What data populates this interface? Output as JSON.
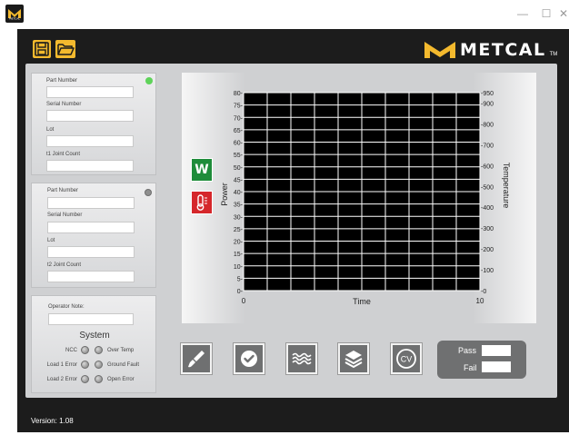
{
  "window": {
    "minimize_glyph": "—",
    "maximize_glyph": "☐",
    "close_glyph": "✕"
  },
  "brand": {
    "name": "METCAL",
    "tm": "TM"
  },
  "panel1": {
    "fields": [
      {
        "label": "Part Number",
        "value": ""
      },
      {
        "label": "Serial Number",
        "value": ""
      },
      {
        "label": "Lot",
        "value": ""
      },
      {
        "label": "t1 Joint Count",
        "value": ""
      }
    ],
    "led_color": "#5fd35a"
  },
  "panel2": {
    "fields": [
      {
        "label": "Part Number",
        "value": ""
      },
      {
        "label": "Serial Number",
        "value": ""
      },
      {
        "label": "Lot",
        "value": ""
      },
      {
        "label": "t2 Joint Count",
        "value": ""
      }
    ],
    "led_color": "#8f8f8f"
  },
  "operator": {
    "label": "Operator Note:",
    "value": ""
  },
  "system": {
    "title": "System",
    "row1_left": "NCC",
    "row1_right": "Over Temp",
    "row2_left": "Load 1 Error",
    "row2_right": "Ground Fault",
    "row3_left": "Load 2 Error",
    "row3_right": "Open Error"
  },
  "chart_data": {
    "type": "line",
    "xlabel": "Time",
    "ylabel": "Power",
    "y2label": "Temperature",
    "xlim": [
      0,
      10
    ],
    "ylim": [
      0,
      80
    ],
    "y2lim": [
      0,
      950
    ],
    "x_ticks": [
      "0",
      "10"
    ],
    "y_ticks": [
      "0-",
      "5-",
      "10-",
      "15-",
      "20-",
      "25-",
      "30-",
      "35-",
      "40-",
      "45-",
      "50-",
      "55-",
      "60-",
      "65-",
      "70-",
      "75-",
      "80-"
    ],
    "y2_ticks": [
      "-0",
      "-100",
      "-200",
      "-300",
      "-400",
      "-500",
      "-600",
      "-700",
      "-800",
      "-900",
      "-950"
    ],
    "y2_tick_values": [
      0,
      100,
      200,
      300,
      400,
      500,
      600,
      700,
      800,
      900,
      950
    ],
    "series": [],
    "grid": true,
    "background": "#000000",
    "grid_color": "#ffffff"
  },
  "indicators": {
    "power_letter": "W",
    "power_color": "#1e8c3a",
    "temp_color": "#d5272b"
  },
  "tools": [
    "brush-icon",
    "check-icon",
    "waves-icon",
    "layers-icon",
    "cv-icon"
  ],
  "tool_cv_text": "CV",
  "passfail": {
    "pass_label": "Pass",
    "fail_label": "Fail",
    "pass_value": "",
    "fail_value": ""
  },
  "version": "Version: 1.08",
  "colors": {
    "accent": "#f3b92e",
    "frame": "#1c1c1c",
    "panel": "#cfd0d2"
  }
}
